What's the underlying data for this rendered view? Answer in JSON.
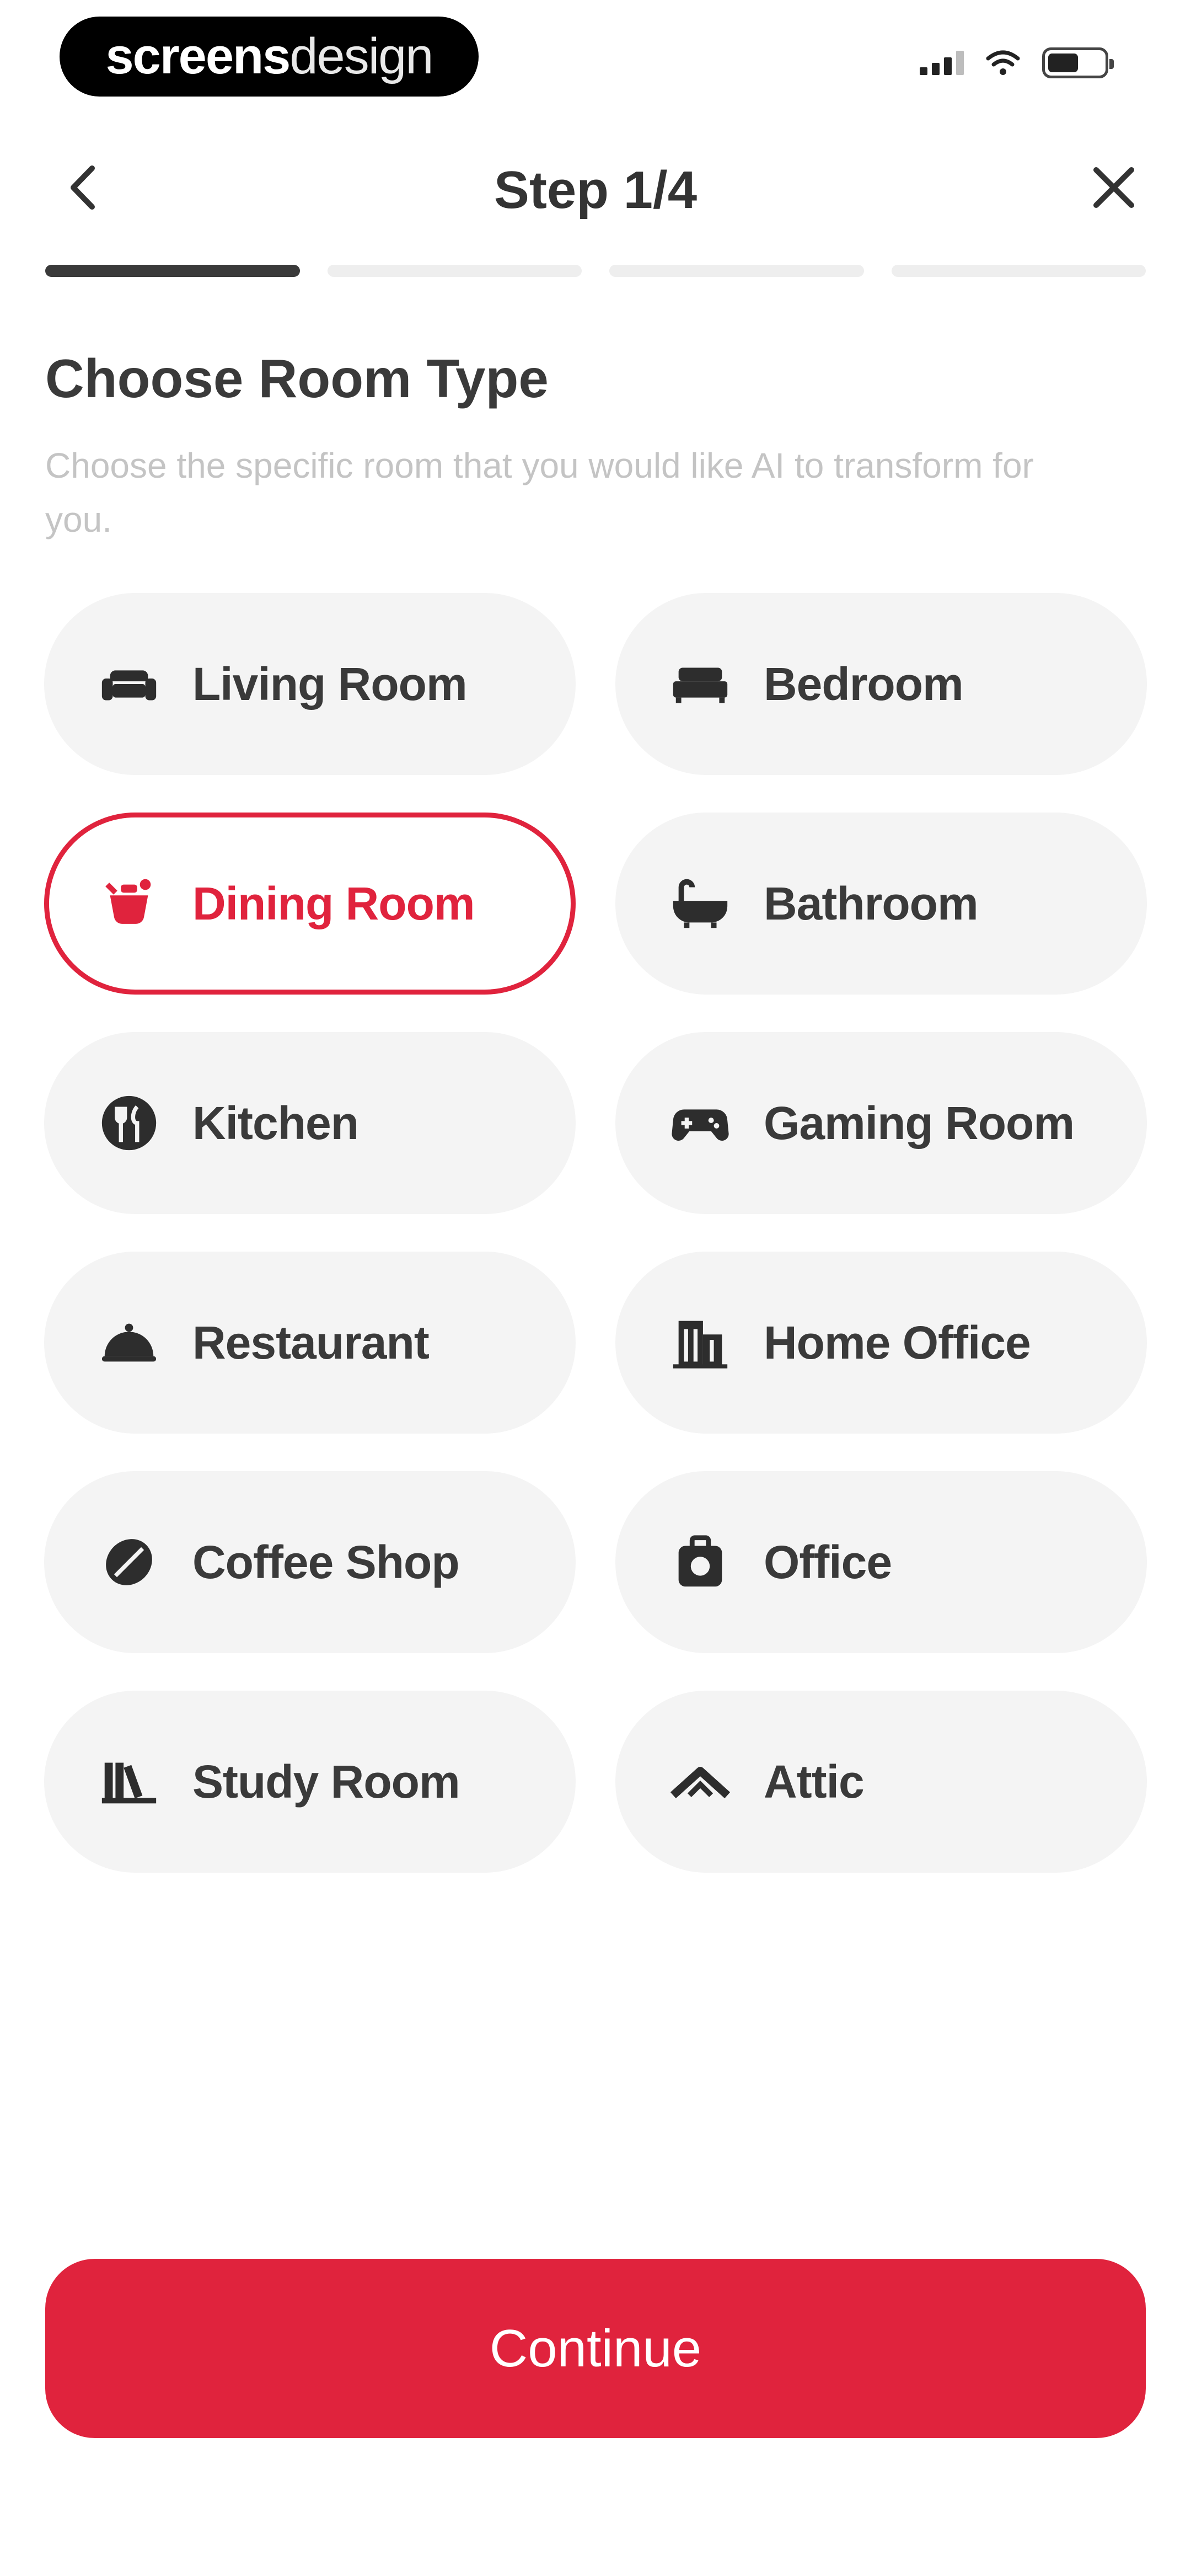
{
  "status_bar": {
    "brand_bold": "screens",
    "brand_light": "design"
  },
  "header": {
    "title": "Step 1/4",
    "back_icon": "chevron-left-icon",
    "close_icon": "close-icon"
  },
  "progress": {
    "current_step": 1,
    "total_steps": 4
  },
  "section": {
    "title": "Choose Room Type",
    "subtitle": "Choose the specific room that you would like AI to transform for you."
  },
  "rooms": [
    {
      "label": "Living Room",
      "icon": "sofa-icon",
      "selected": false
    },
    {
      "label": "Bedroom",
      "icon": "bed-icon",
      "selected": false
    },
    {
      "label": "Dining Room",
      "icon": "dining-icon",
      "selected": true
    },
    {
      "label": "Bathroom",
      "icon": "bathtub-icon",
      "selected": false
    },
    {
      "label": "Kitchen",
      "icon": "kitchen-icon",
      "selected": false
    },
    {
      "label": "Gaming Room",
      "icon": "gamepad-icon",
      "selected": false
    },
    {
      "label": "Restaurant",
      "icon": "cloche-icon",
      "selected": false
    },
    {
      "label": "Home Office",
      "icon": "building-icon",
      "selected": false
    },
    {
      "label": "Coffee Shop",
      "icon": "coffee-bean-icon",
      "selected": false
    },
    {
      "label": "Office",
      "icon": "briefcase-icon",
      "selected": false
    },
    {
      "label": "Study Room",
      "icon": "books-icon",
      "selected": false
    },
    {
      "label": "Attic",
      "icon": "roof-icon",
      "selected": false
    }
  ],
  "colors": {
    "accent": "#e0233d",
    "card_bg": "#f4f4f4",
    "text": "#3a3a3a",
    "muted_text": "#c4c4c4"
  },
  "continue_label": "Continue"
}
